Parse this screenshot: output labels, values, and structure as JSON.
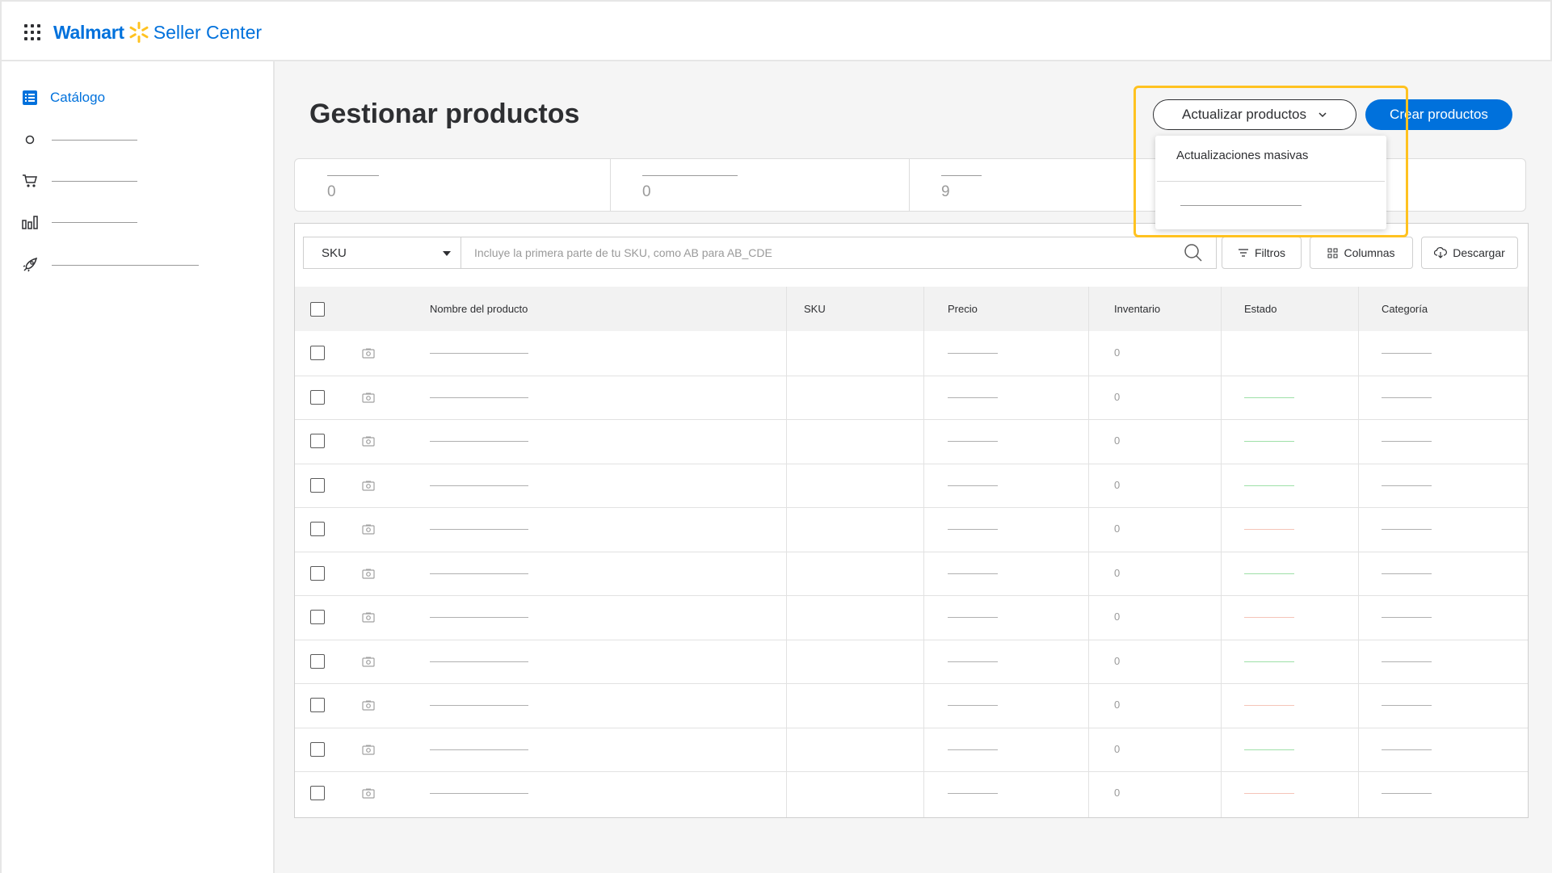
{
  "brand": {
    "walmart": "Walmart",
    "seller_center": "Seller Center",
    "spark_color": "#ffc220",
    "blue": "#0071dc"
  },
  "sidebar": {
    "items": [
      {
        "label": "Catálogo",
        "icon": "list-icon",
        "active": true
      },
      {
        "label": "",
        "icon": "circle-icon"
      },
      {
        "label": "",
        "icon": "cart-icon"
      },
      {
        "label": "",
        "icon": "bar-chart-icon"
      },
      {
        "label": "",
        "icon": "rocket-icon"
      }
    ]
  },
  "page": {
    "title": "Gestionar productos"
  },
  "actions": {
    "update_label": "Actualizar productos",
    "create_label": "Crear productos",
    "dropdown": {
      "items": [
        {
          "label": "Actualizaciones masivas"
        },
        {
          "label": ""
        }
      ]
    }
  },
  "stats": [
    {
      "value": "0"
    },
    {
      "value": "0"
    },
    {
      "value": "9"
    },
    {
      "value": ""
    }
  ],
  "toolbar": {
    "select_value": "SKU",
    "search_placeholder": "Incluye la primera parte de tu SKU, como AB para AB_CDE",
    "filters_label": "Filtros",
    "columns_label": "Columnas",
    "download_label": "Descargar"
  },
  "table": {
    "headers": {
      "name": "Nombre del producto",
      "sku": "SKU",
      "price": "Precio",
      "inventory": "Inventario",
      "status": "Estado",
      "category": "Categoría"
    },
    "rows": [
      {
        "inventory": "0",
        "status_color": ""
      },
      {
        "inventory": "0",
        "status_color": "#9ee0a8"
      },
      {
        "inventory": "0",
        "status_color": "#9ee0a8"
      },
      {
        "inventory": "0",
        "status_color": "#9ee0a8"
      },
      {
        "inventory": "0",
        "status_color": "#f5c4b8"
      },
      {
        "inventory": "0",
        "status_color": "#9ee0a8"
      },
      {
        "inventory": "0",
        "status_color": "#f5c4b8"
      },
      {
        "inventory": "0",
        "status_color": "#9ee0a8"
      },
      {
        "inventory": "0",
        "status_color": "#f5c4b8"
      },
      {
        "inventory": "0",
        "status_color": "#9ee0a8"
      },
      {
        "inventory": "0",
        "status_color": "#f5c4b8"
      }
    ]
  }
}
